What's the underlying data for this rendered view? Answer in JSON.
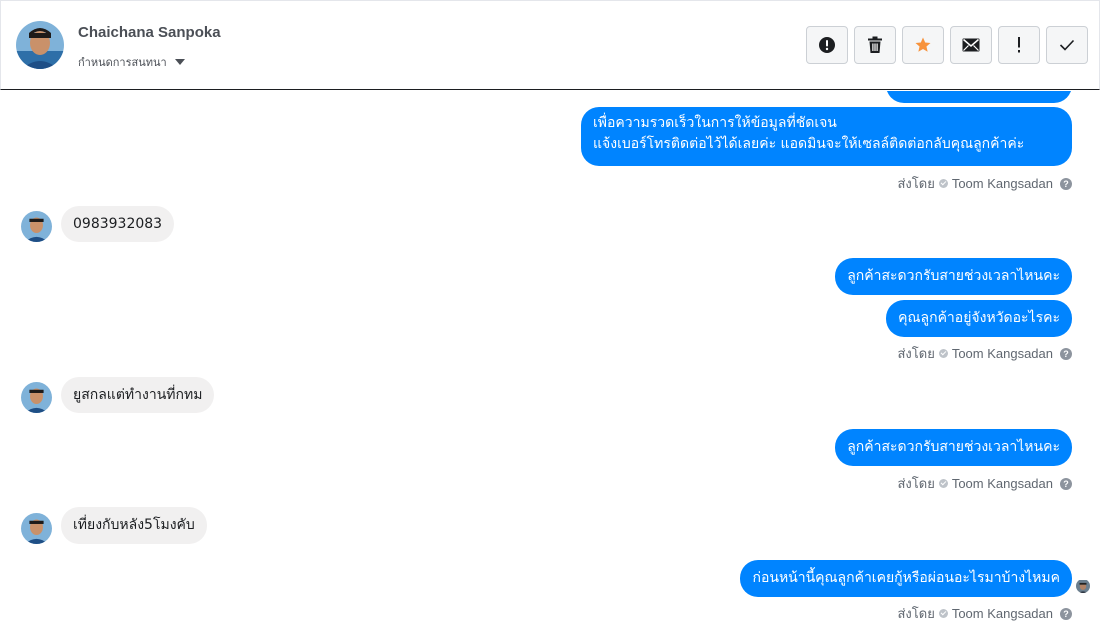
{
  "header": {
    "contact_name": "Chaichana Sanpoka",
    "assign_label": "กำหนดการสนทนา",
    "actions": [
      {
        "name": "spam-icon",
        "label": "spam"
      },
      {
        "name": "trash-icon",
        "label": "delete"
      },
      {
        "name": "star-icon",
        "label": "star"
      },
      {
        "name": "envelope-icon",
        "label": "mark unread"
      },
      {
        "name": "exclamation-icon",
        "label": "follow up"
      },
      {
        "name": "checkmark-icon",
        "label": "done"
      }
    ],
    "colors": {
      "star": "#f7923b",
      "divider": "#1c1e21"
    }
  },
  "messages": {
    "partial_top": "",
    "out1_line1": "เพื่อความรวดเร็วในการให้ข้อมูลที่ชัดเจน",
    "out1_line2": "แจ้งเบอร์โทรติดต่อไว้ได้เลยค่ะ แอดมินจะให้เซลล์ติดต่อกลับคุณลูกค้าค่ะ",
    "in1": "0983932083",
    "out2": "ลูกค้าสะดวกรับสายช่วงเวลาไหนคะ",
    "out3": "คุณลูกค้าอยู่จังหวัดอะไรคะ",
    "in2": "ยูสกลแต่ทำงานที่กทม",
    "out4": "ลูกค้าสะดวกรับสายช่วงเวลาไหนคะ",
    "in3": "เที่ยงกับหลัง5โมงคับ",
    "out5": "ก่อนหน้านี้คุณลูกค้าเคยกู้หรือผ่อนอะไรมาบ้างไหมค"
  },
  "sent_by": {
    "prefix": "ส่งโดย",
    "agent": "Toom Kangsadan",
    "help": "?"
  },
  "colors": {
    "outgoing_bubble": "#0084ff",
    "incoming_bubble": "#f1f0f0"
  }
}
